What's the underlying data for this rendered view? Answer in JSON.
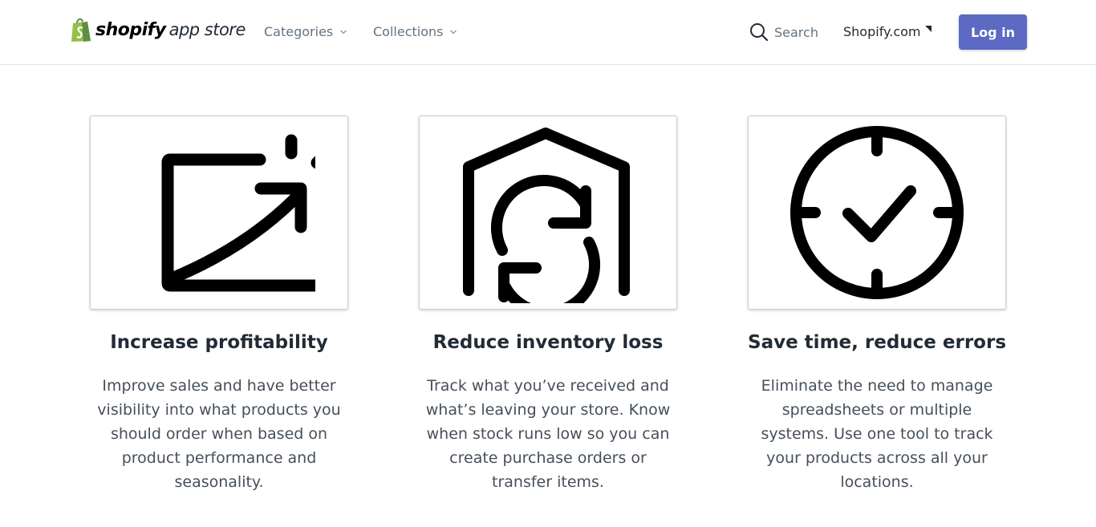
{
  "header": {
    "logo_word": "shopify",
    "logo_sub": "app store",
    "nav": [
      {
        "label": "Categories"
      },
      {
        "label": "Collections"
      }
    ],
    "search_label": "Search",
    "shopify_link": "Shopify.com",
    "login_label": "Log in"
  },
  "colors": {
    "brand_green": "#95bf47",
    "login_button": "#5c6ac4",
    "border": "#c4cdd5"
  },
  "features": [
    {
      "icon": "growth-chart-icon",
      "title": "Increase profitability",
      "text": "Improve sales and have better visibility into what products you should order when based on product performance and seasonality."
    },
    {
      "icon": "warehouse-sync-icon",
      "title": "Reduce inventory loss",
      "text": "Track what you’ve received and what’s leaving your store. Know when stock runs low so you can create purchase orders or transfer items."
    },
    {
      "icon": "clock-check-icon",
      "title": "Save time, reduce errors",
      "text": "Eliminate the need to manage spreadsheets or multiple systems. Use one tool to track your products across all your locations."
    }
  ]
}
